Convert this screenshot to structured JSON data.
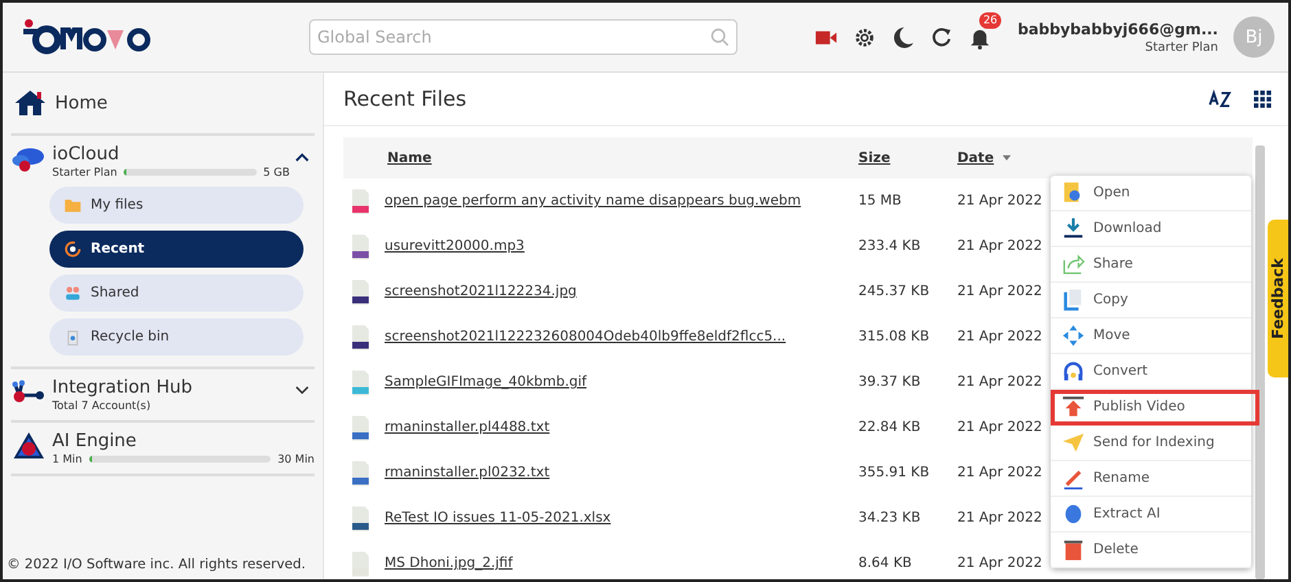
{
  "header": {
    "search": {
      "placeholder": "Global Search"
    },
    "notifications": "26",
    "user": {
      "email": "babbybabbyj666@gm...",
      "plan": "Starter Plan",
      "initials": "Bj"
    }
  },
  "sidebar": {
    "home": "Home",
    "iocloud": {
      "title": "ioCloud",
      "plan": "Starter Plan",
      "level": 0.01,
      "capacity": "5 GB",
      "expanded": true,
      "items": [
        {
          "label": "My files",
          "selected": false
        },
        {
          "label": "Recent",
          "selected": true
        },
        {
          "label": "Shared",
          "selected": false
        },
        {
          "label": "Recycle bin",
          "selected": false
        }
      ]
    },
    "integration": {
      "title": "Integration Hub",
      "subtitle": "Total 7 Account(s)",
      "expanded": false
    },
    "ai": {
      "title": "AI Engine",
      "min": "1 Min",
      "max": "30 Min",
      "level": 0.02
    },
    "footer": "© 2022 I/O Software inc. All rights reserved."
  },
  "main": {
    "title": "Recent Files",
    "columns": [
      {
        "label": "Name",
        "sorted": false
      },
      {
        "label": "Size",
        "sorted": false
      },
      {
        "label": "Date",
        "sorted": true
      }
    ],
    "rows": [
      {
        "name": "open page perform any activity name disappears bug.webm",
        "size": "15 MB",
        "date": "21 Apr 2022",
        "color": "#e8336b"
      },
      {
        "name": "usurevitt20000.mp3",
        "size": "233.4 KB",
        "date": "21 Apr 2022",
        "color": "#7b4fa6"
      },
      {
        "name": "screenshot2021l122234.jpg",
        "size": "245.37 KB",
        "date": "21 Apr 2022",
        "color": "#3a2f7a"
      },
      {
        "name": "screenshot2021l122232608004Odeb40lb9ffe8eldf2flcc5...",
        "size": "315.08 KB",
        "date": "21 Apr 2022",
        "color": "#3a2f7a"
      },
      {
        "name": "SampleGIFImage_40kbmb.gif",
        "size": "39.37 KB",
        "date": "21 Apr 2022",
        "color": "#3cb9d6"
      },
      {
        "name": "rmaninstaller.pl4488.txt",
        "size": "22.84 KB",
        "date": "21 Apr 2022",
        "color": "#3a6fc4"
      },
      {
        "name": "rmaninstaller.pl0232.txt",
        "size": "355.91 KB",
        "date": "21 Apr 2022",
        "color": "#3a6fc4"
      },
      {
        "name": "ReTest IO issues 11-05-2021.xlsx",
        "size": "34.23 KB",
        "date": "21 Apr 2022",
        "color": "#2a5a8a"
      },
      {
        "name": "MS Dhoni.jpg_2.jfif",
        "size": "8.64 KB",
        "date": "21 Apr 2022",
        "color": "#e4e6dc"
      }
    ],
    "context_menu": [
      {
        "label": "Open",
        "highlighted": false
      },
      {
        "label": "Download",
        "highlighted": false
      },
      {
        "label": "Share",
        "highlighted": false
      },
      {
        "label": "Copy",
        "highlighted": false
      },
      {
        "label": "Move",
        "highlighted": false
      },
      {
        "label": "Convert",
        "highlighted": false
      },
      {
        "label": "Publish Video",
        "highlighted": true
      },
      {
        "label": "Send for Indexing",
        "highlighted": false
      },
      {
        "label": "Rename",
        "highlighted": false
      },
      {
        "label": "Extract AI",
        "highlighted": false
      },
      {
        "label": "Delete",
        "highlighted": false
      }
    ]
  },
  "feedback": "Feedback"
}
